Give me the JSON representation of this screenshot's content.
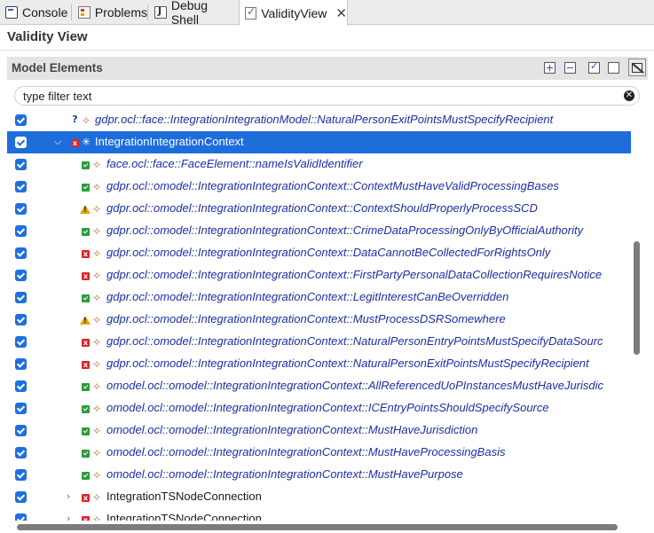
{
  "tabs": [
    {
      "label": "Console",
      "icon": "console-icon"
    },
    {
      "label": "Problems",
      "icon": "problems-icon"
    },
    {
      "label": "Debug Shell",
      "icon": "debug-shell-icon"
    },
    {
      "label": "ValidityView",
      "icon": "validity-view-icon",
      "close": "✕"
    }
  ],
  "view_title": "Validity View",
  "section": {
    "title": "Model Elements",
    "buttons": [
      "expand-all-icon",
      "collapse-all-icon",
      "check-all-icon",
      "uncheck-all-icon",
      "filter-toggle-icon"
    ]
  },
  "filter": {
    "placeholder": "type filter text",
    "value": "",
    "clear": "✕"
  },
  "tree": {
    "rows": [
      {
        "label": "gdpr.ocl::face::IntegrationIntegrationModel::NaturalPersonExitPointsMustSpecifyRecipient",
        "status": "unknown",
        "status_text": "?",
        "type": "constraint"
      },
      {
        "label": "IntegrationIntegrationContext",
        "status": "error",
        "status_text": "x",
        "type": "context",
        "expanded": "⌵",
        "selected": true
      },
      {
        "label": "face.ocl::face::FaceElement::nameIsValidIdentifier",
        "status": "ok",
        "type": "constraint"
      },
      {
        "label": "gdpr.ocl::omodel::IntegrationIntegrationContext::ContextMustHaveValidProcessingBases",
        "status": "ok",
        "type": "constraint"
      },
      {
        "label": "gdpr.ocl::omodel::IntegrationIntegrationContext::ContextShouldProperlyProcessSCD",
        "status": "warning",
        "type": "constraint"
      },
      {
        "label": "gdpr.ocl::omodel::IntegrationIntegrationContext::CrimeDataProcessingOnlyByOfficialAuthority",
        "status": "ok",
        "type": "constraint"
      },
      {
        "label": "gdpr.ocl::omodel::IntegrationIntegrationContext::DataCannotBeCollectedForRightsOnly",
        "status": "error",
        "status_text": "x",
        "type": "constraint"
      },
      {
        "label": "gdpr.ocl::omodel::IntegrationIntegrationContext::FirstPartyPersonalDataCollectionRequiresNotice",
        "status": "error",
        "status_text": "x",
        "type": "constraint"
      },
      {
        "label": "gdpr.ocl::omodel::IntegrationIntegrationContext::LegitInterestCanBeOverridden",
        "status": "ok",
        "type": "constraint"
      },
      {
        "label": "gdpr.ocl::omodel::IntegrationIntegrationContext::MustProcessDSRSomewhere",
        "status": "warning",
        "type": "constraint"
      },
      {
        "label": "gdpr.ocl::omodel::IntegrationIntegrationContext::NaturalPersonEntryPointsMustSpecifyDataSourc",
        "status": "error",
        "status_text": "x",
        "type": "constraint"
      },
      {
        "label": "gdpr.ocl::omodel::IntegrationIntegrationContext::NaturalPersonExitPointsMustSpecifyRecipient",
        "status": "error",
        "status_text": "x",
        "type": "constraint"
      },
      {
        "label": "omodel.ocl::omodel::IntegrationIntegrationContext::AllReferencedUoPInstancesMustHaveJurisdic",
        "status": "ok",
        "type": "constraint"
      },
      {
        "label": "omodel.ocl::omodel::IntegrationIntegrationContext::ICEntryPointsShouldSpecifySource",
        "status": "ok",
        "type": "constraint"
      },
      {
        "label": "omodel.ocl::omodel::IntegrationIntegrationContext::MustHaveJurisdiction",
        "status": "ok",
        "type": "constraint"
      },
      {
        "label": "omodel.ocl::omodel::IntegrationIntegrationContext::MustHaveProcessingBasis",
        "status": "ok",
        "type": "constraint"
      },
      {
        "label": "omodel.ocl::omodel::IntegrationIntegrationContext::MustHavePurpose",
        "status": "ok",
        "type": "constraint"
      },
      {
        "label": "IntegrationTSNodeConnection",
        "status": "error",
        "status_text": "x",
        "type": "element",
        "expanded": "›"
      },
      {
        "label": "IntegrationTSNodeConnection",
        "status": "error",
        "status_text": "x",
        "type": "element",
        "expanded": "›"
      }
    ]
  },
  "colors": {
    "accent": "#1d6ddb",
    "link_italic": "#1c2fa8",
    "error": "#d8262a",
    "ok": "#2e9b3a",
    "warning": "#e8a000"
  }
}
